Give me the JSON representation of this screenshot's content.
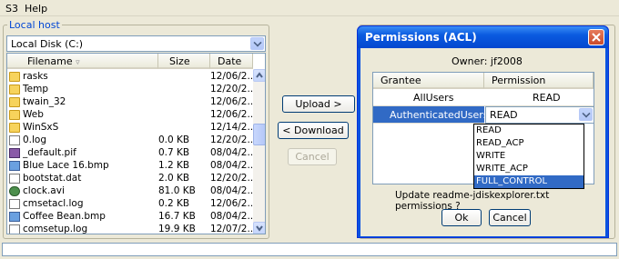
{
  "menu": [
    "S3",
    "Help"
  ],
  "local": {
    "group_title": "Local host",
    "drive_value": "Local Disk (C:)",
    "columns": [
      "Filename",
      "Size",
      "Date"
    ],
    "files": [
      {
        "name": "rasks",
        "size": "",
        "date": "12/06/2...",
        "icon": "folder-icon"
      },
      {
        "name": "Temp",
        "size": "",
        "date": "12/20/2...",
        "icon": "folder-icon"
      },
      {
        "name": "twain_32",
        "size": "",
        "date": "12/06/2...",
        "icon": "folder-icon"
      },
      {
        "name": "Web",
        "size": "",
        "date": "12/06/2...",
        "icon": "folder-icon"
      },
      {
        "name": "WinSxS",
        "size": "",
        "date": "12/14/2...",
        "icon": "folder-icon"
      },
      {
        "name": "0.log",
        "size": "0.0 KB",
        "date": "12/20/2...",
        "icon": "document-icon"
      },
      {
        "name": "_default.pif",
        "size": "0.7 KB",
        "date": "08/04/2...",
        "icon": "app-icon"
      },
      {
        "name": "Blue Lace 16.bmp",
        "size": "1.2 KB",
        "date": "08/04/2...",
        "icon": "image-icon"
      },
      {
        "name": "bootstat.dat",
        "size": "2.0 KB",
        "date": "12/20/2...",
        "icon": "document-icon"
      },
      {
        "name": "clock.avi",
        "size": "81.0 KB",
        "date": "08/04/2...",
        "icon": "video-icon"
      },
      {
        "name": "cmsetacl.log",
        "size": "0.2 KB",
        "date": "12/06/2...",
        "icon": "document-icon"
      },
      {
        "name": "Coffee Bean.bmp",
        "size": "16.7 KB",
        "date": "08/04/2...",
        "icon": "image-icon"
      },
      {
        "name": "comsetup.log",
        "size": "19.9 KB",
        "date": "12/07/2...",
        "icon": "document-icon"
      }
    ]
  },
  "buttons": {
    "upload": "Upload >",
    "download": "< Download",
    "cancel": "Cancel"
  },
  "dialog": {
    "title": "Permissions (ACL)",
    "close": "X",
    "owner_label": "Owner: jf2008",
    "columns": [
      "Grantee",
      "Permission"
    ],
    "rows": [
      {
        "grantee": "AllUsers",
        "permission": "READ"
      },
      {
        "grantee": "AuthenticatedUsers",
        "permission": "READ"
      }
    ],
    "options": [
      "READ",
      "READ_ACP",
      "WRITE",
      "WRITE_ACP",
      "FULL_CONTROL"
    ],
    "selected_option": "FULL_CONTROL",
    "message": "Update readme-jdiskexplorer.txt permissions ?",
    "ok": "Ok",
    "cancel": "Cancel"
  },
  "colors": {
    "accent": "#0a53e0",
    "selection": "#316ac5",
    "group_title": "#0046d5"
  }
}
